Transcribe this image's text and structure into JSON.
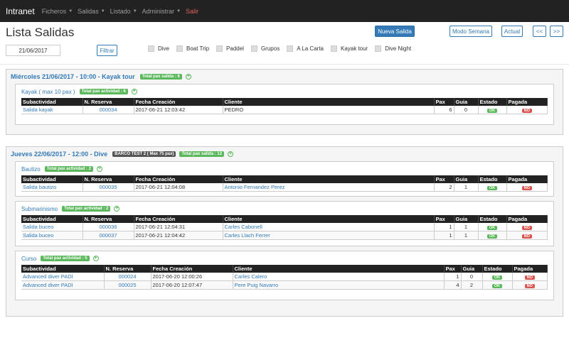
{
  "navbar": {
    "brand": "Intranet",
    "items": [
      "Ficheros",
      "Salidas",
      "Listado",
      "Administrar"
    ],
    "logout": "Salir"
  },
  "page": {
    "title": "Lista Salidas",
    "new_button": "Nueva Salida",
    "week_button": "Modo Semana",
    "current_button": "Actual",
    "prev_button": "<<",
    "next_button": ">>",
    "date_value": "21/06/2017",
    "filter_button": "Filtrar",
    "filters": [
      "Dive",
      "Boat Trip",
      "Paddel",
      "Grupos",
      "A La Carta",
      "Kayak tour",
      "Dive Night"
    ]
  },
  "columns": [
    "Subactividad",
    "N. Reserva",
    "Fecha Creación",
    "Cliente",
    "Pax",
    "Guia",
    "Estado",
    "Pagada"
  ],
  "salidas": [
    {
      "title": "Miércoles 21/06/2017 - 10:00 - Kayak tour",
      "boat": "",
      "total": "Total pax salida : 6",
      "actividades": [
        {
          "title": "Kayak ( max 10 pax )",
          "total": "Total pax actividad : 6",
          "rows": [
            {
              "sub": "Salida kayak",
              "reserva": "000034",
              "fecha": "2017-06-21 12:03:42",
              "cliente": "PEDRO",
              "pax": "6",
              "guia": "0",
              "estado": "OK",
              "pagada": "NO"
            }
          ]
        }
      ]
    },
    {
      "title": "Jueves 22/06/2017 - 12:00 - Dive",
      "boat": "BARCO TEST 2 ( Max 75 pax)",
      "total": "Total pax salida : 12",
      "actividades": [
        {
          "title": "Bautizo",
          "total": "Total pax actividad : 2",
          "rows": [
            {
              "sub": "Salida bautizo",
              "reserva": "000035",
              "fecha": "2017-06-21 12:04:08",
              "cliente": "Antonio Fernandez Perez",
              "pax": "2",
              "guia": "1",
              "estado": "OK",
              "pagada": "NO"
            }
          ]
        },
        {
          "title": "Submarinismo",
          "total": "Total pax actividad : 2",
          "rows": [
            {
              "sub": "Salida buceo",
              "reserva": "000036",
              "fecha": "2017-06-21 12:04:31",
              "cliente": "Carles Cabonell",
              "pax": "1",
              "guia": "1",
              "estado": "OK",
              "pagada": "NO"
            },
            {
              "sub": "Salida buceo",
              "reserva": "000037",
              "fecha": "2017-06-21 12:04:42",
              "cliente": "Carles Llach Ferrer",
              "pax": "1",
              "guia": "1",
              "estado": "OK",
              "pagada": "NO"
            }
          ]
        },
        {
          "title": "Curso",
          "total": "Total pax actividad : 5",
          "rows": [
            {
              "sub": "Advanced diver PADI",
              "reserva": "000024",
              "fecha": "2017-06-20 12:00:26",
              "cliente": "Carles Calero",
              "pax": "1",
              "guia": "0",
              "estado": "OK",
              "pagada": "NO"
            },
            {
              "sub": "Advanced diver PADI",
              "reserva": "000025",
              "fecha": "2017-06-20 12:07:47",
              "cliente": "Pere Puig Navarro",
              "pax": "4",
              "guia": "2",
              "estado": "OK",
              "pagada": "NO"
            }
          ]
        }
      ]
    }
  ]
}
